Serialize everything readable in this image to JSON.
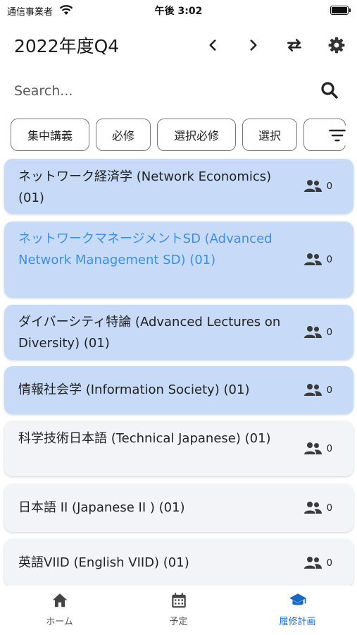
{
  "status_bar": {
    "carrier": "通信事業者",
    "time": "午後 3:02"
  },
  "header": {
    "title": "2022年度Q4"
  },
  "search": {
    "placeholder": "Search..."
  },
  "filters": [
    "集中講義",
    "必修",
    "選択必修",
    "選択"
  ],
  "courses": [
    {
      "title": "ネットワーク経済学 (Network Economics) (01)",
      "count": "0",
      "selected": true
    },
    {
      "title": "ネットワークマネージメントSD (Advanced Network Management SD) (01)",
      "count": "0",
      "selected": true
    },
    {
      "title": "ダイバーシティ特論 (Advanced Lectures on Diversity) (01)",
      "count": "0",
      "selected": true
    },
    {
      "title": "情報社会学 (Information Society) (01)",
      "count": "0",
      "selected": true
    },
    {
      "title": "科学技術日本語 (Technical Japanese) (01)",
      "count": "0",
      "selected": false
    },
    {
      "title": "日本語 II (Japanese II ) (01)",
      "count": "0",
      "selected": false
    },
    {
      "title": "英語VIID (English VIID) (01)",
      "count": "0",
      "selected": false
    }
  ],
  "bottom_nav": [
    {
      "label": "ホーム",
      "icon": "home-icon"
    },
    {
      "label": "予定",
      "icon": "calendar-icon"
    },
    {
      "label": "履修計画",
      "icon": "graduation-cap-icon",
      "active": true
    }
  ],
  "colors": {
    "selected_card": "#c7dbf8",
    "plain_card": "#f2f4f7",
    "accent": "#1967c4",
    "link_text": "#3e8ee8"
  }
}
